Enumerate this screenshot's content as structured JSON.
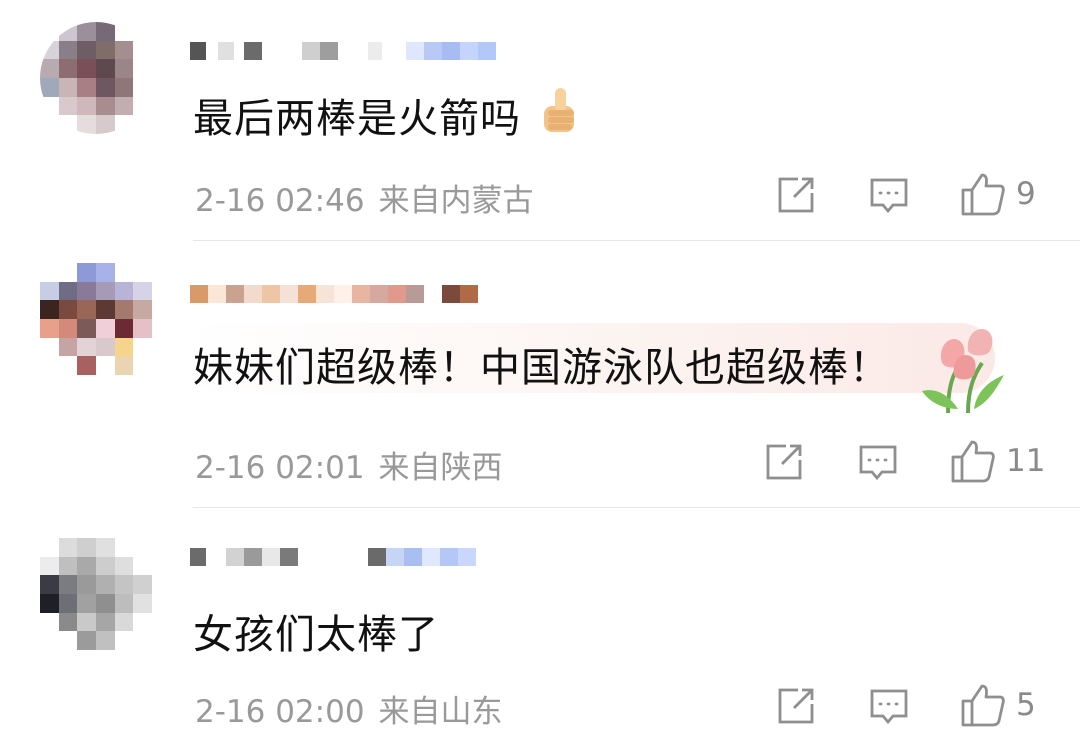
{
  "comments": [
    {
      "text": "最后两棒是火箭吗",
      "time": "2-16 02:46",
      "location": "来自内蒙古",
      "likes": "9",
      "emoji": "thumbs-up",
      "avatar_colors": [
        "#ffffff",
        "#cdc6d0",
        "#9b8f9c",
        "#766a76",
        "#ffffff",
        "#ffffff",
        "#d8d3da",
        "#8a7e88",
        "#6f5d65",
        "#7f6d6a",
        "#a38f90",
        "#ffffff",
        "#b7aab1",
        "#8e6d70",
        "#7a4f57",
        "#5e4a4e",
        "#9a8588",
        "#ffffff",
        "#9fa9b9",
        "#c9b4b6",
        "#a77f84",
        "#6e5760",
        "#8f7779",
        "#ffffff",
        "#ffffff",
        "#d9c9cc",
        "#ceb8bb",
        "#a98c90",
        "#c2adb0",
        "#ffffff",
        "#ffffff",
        "#ffffff",
        "#e6dcde",
        "#d6cacd",
        "#ffffff",
        "#ffffff"
      ]
    },
    {
      "text": "妹妹们超级棒！中国游泳队也超级棒！",
      "time": "2-16 02:01",
      "location": "来自陕西",
      "likes": "11",
      "emoji": "tulip",
      "avatar_colors": [
        "#ffffff",
        "#ffffff",
        "#8e9ad8",
        "#a7b1ea",
        "#ffffff",
        "#ffffff",
        "#c7cde5",
        "#6f6d86",
        "#8a7a9a",
        "#a59bb7",
        "#b7b4d8",
        "#d6d3e9",
        "#3a2520",
        "#7a4a3e",
        "#9a6657",
        "#5c3a33",
        "#a47a6c",
        "#c6aaa2",
        "#e8a08b",
        "#d38a7a",
        "#7b5b58",
        "#f1cfd9",
        "#6b2a34",
        "#e5c1c7",
        "#ffffff",
        "#c5a4a4",
        "#e3d3d6",
        "#d9c8cc",
        "#f6d58a",
        "#ffffff",
        "#ffffff",
        "#ffffff",
        "#a86060",
        "#ffffff",
        "#ead4b2",
        "#ffffff"
      ]
    },
    {
      "text": "女孩们太棒了",
      "time": "2-16 02:00",
      "location": "来自山东",
      "likes": "5",
      "emoji": "",
      "avatar_colors": [
        "#ffffff",
        "#dcdcdc",
        "#cfcfcf",
        "#e0e0e0",
        "#ffffff",
        "#ffffff",
        "#ececec",
        "#bfbfbf",
        "#a9a9a9",
        "#cdcdcd",
        "#dedede",
        "#ffffff",
        "#3b3b45",
        "#7b7b82",
        "#9a9a9a",
        "#b0b0b0",
        "#c4c4c4",
        "#d0d0d0",
        "#1f1f28",
        "#6e6e76",
        "#a1a1a1",
        "#8f8f8f",
        "#bdbdbd",
        "#e1e1e1",
        "#ffffff",
        "#8a8a8a",
        "#c9c9c9",
        "#a6a6a6",
        "#d9d9d9",
        "#ffffff",
        "#ffffff",
        "#ffffff",
        "#9b9b9b",
        "#c0c0c0",
        "#ffffff",
        "#ffffff"
      ]
    }
  ],
  "icons": {
    "share": "share-icon",
    "reply": "comment-icon",
    "like": "thumbs-up-icon"
  },
  "colors": {
    "meta": "#999999",
    "text": "#111111",
    "divider": "#e6e6e6"
  }
}
